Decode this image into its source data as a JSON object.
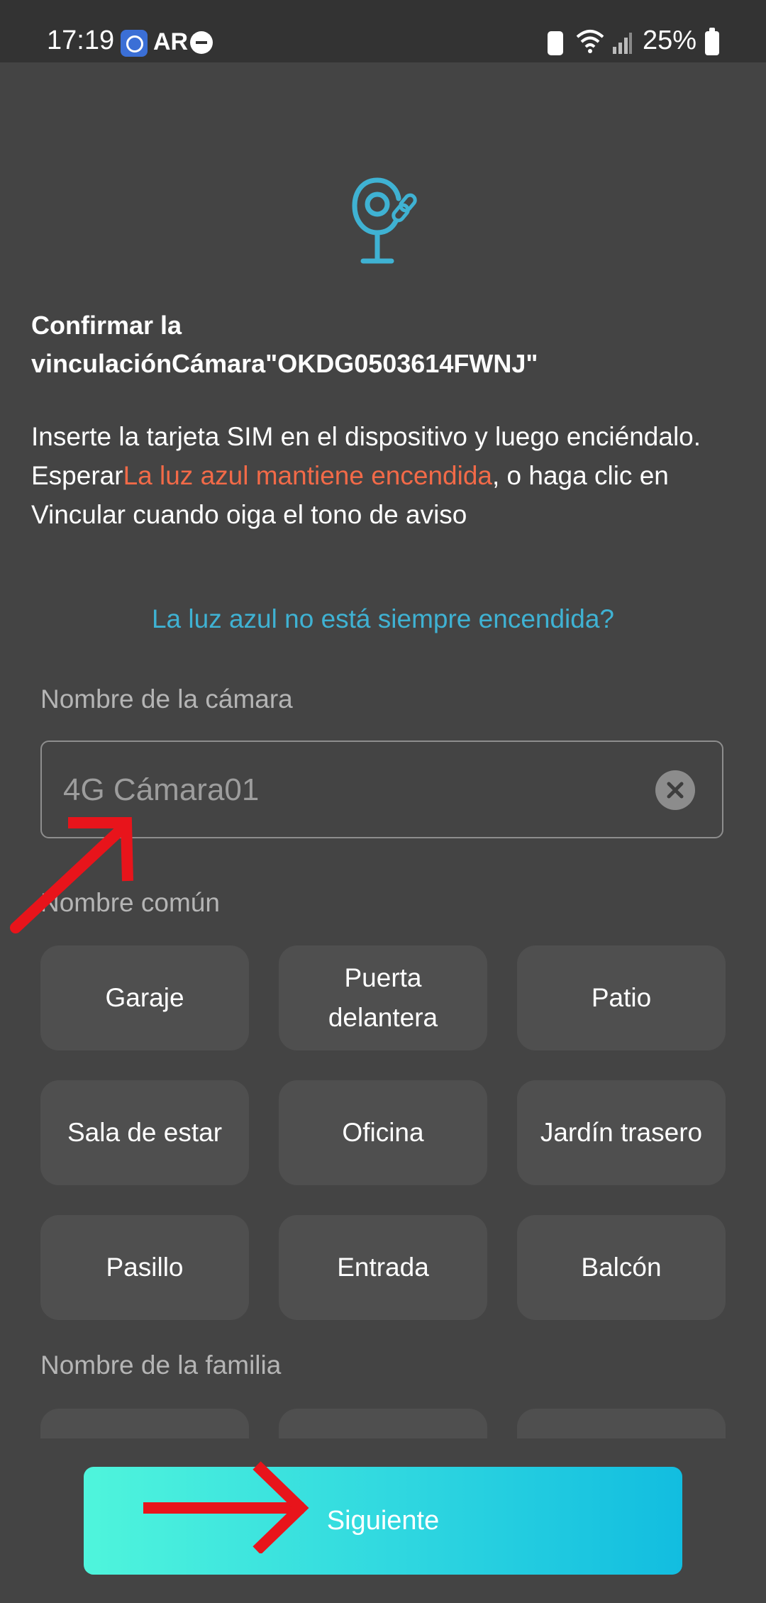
{
  "status_bar": {
    "time": "17:19",
    "battery_percent": "25%",
    "app_icons": [
      "camera-app-icon",
      "ar-icon",
      "do-not-disturb-icon"
    ],
    "right_icons": [
      "battery-saver-icon",
      "wifi-icon",
      "signal-icon",
      "battery-icon"
    ]
  },
  "header": {
    "icon": "camera-link-icon",
    "title_line1": "Confirmar la",
    "title_line2": "vinculaciónCámara\"OKDG0503614FWNJ\""
  },
  "instructions": {
    "line1": "Inserte la tarjeta SIM en el dispositivo y luego enciéndalo.",
    "wait_prefix": "Esperar",
    "highlight": "La luz azul mantiene encendida",
    "suffix": ", o haga clic en Vincular cuando oiga el tono de aviso"
  },
  "help_link": "La luz azul no está siempre encendida?",
  "camera_name": {
    "label": "Nombre de la cámara",
    "placeholder": "4G Cámara01",
    "value": ""
  },
  "common_names": {
    "label": "Nombre común",
    "items": [
      "Garaje",
      "Puerta delantera",
      "Patio",
      "Sala de estar",
      "Oficina",
      "Jardín trasero",
      "Pasillo",
      "Entrada",
      "Balcón"
    ]
  },
  "family_names": {
    "label": "Nombre de la familia"
  },
  "footer": {
    "next_label": "Siguiente"
  },
  "colors": {
    "background": "#444444",
    "status_bar": "#333333",
    "accent_link": "#3fb2d3",
    "highlight": "#f26a48",
    "chip": "#4f4f4f",
    "button_gradient_start": "#4ff5dc",
    "button_gradient_end": "#12bde0",
    "annotation_arrow": "#e8141b"
  }
}
